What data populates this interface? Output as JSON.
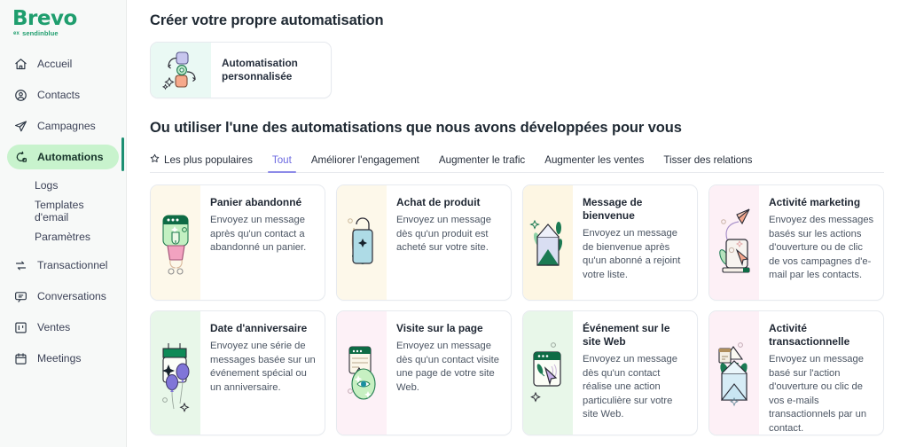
{
  "sidebar": {
    "logo": {
      "name": "Brevo",
      "prefix": "ex",
      "subname": "sendinblue"
    },
    "items": [
      {
        "label": "Accueil",
        "icon": "home-icon",
        "active": false,
        "sub": false
      },
      {
        "label": "Contacts",
        "icon": "contacts-icon",
        "active": false,
        "sub": false
      },
      {
        "label": "Campagnes",
        "icon": "send-icon",
        "active": false,
        "sub": false
      },
      {
        "label": "Automations",
        "icon": "automations-icon",
        "active": true,
        "sub": false
      },
      {
        "label": "Logs",
        "icon": "",
        "active": false,
        "sub": true
      },
      {
        "label": "Templates d'email",
        "icon": "",
        "active": false,
        "sub": true
      },
      {
        "label": "Paramètres",
        "icon": "",
        "active": false,
        "sub": true
      },
      {
        "label": "Transactionnel",
        "icon": "transactional-icon",
        "active": false,
        "sub": false
      },
      {
        "label": "Conversations",
        "icon": "chat-icon",
        "active": false,
        "sub": false
      },
      {
        "label": "Ventes",
        "icon": "sales-board-icon",
        "active": false,
        "sub": false
      },
      {
        "label": "Meetings",
        "icon": "calendar-icon",
        "active": false,
        "sub": false
      }
    ]
  },
  "main": {
    "section1_title": "Créer votre propre automatisation",
    "custom_card": {
      "label": "Automatisation personnalisée",
      "art_bg": "#eaf9f4"
    },
    "section2_title": "Ou utiliser l'une des automatisations que nous avons développées pour vous",
    "tabs": [
      {
        "label": "Les plus populaires",
        "icon": "star-icon",
        "active": false
      },
      {
        "label": "Tout",
        "icon": "",
        "active": true
      },
      {
        "label": "Améliorer l'engagement",
        "icon": "",
        "active": false
      },
      {
        "label": "Augmenter le trafic",
        "icon": "",
        "active": false
      },
      {
        "label": "Augmenter les ventes",
        "icon": "",
        "active": false
      },
      {
        "label": "Tisser des relations",
        "icon": "",
        "active": false
      }
    ],
    "accent_color": "#6c6ae0",
    "brand_color": "#1f9e6e",
    "cards": [
      {
        "title": "Panier abandonné",
        "desc": "Envoyez un message après qu'un contact a abandonné un panier.",
        "art": "abandoned-cart-illustration",
        "art_bg": "#fdf8ea"
      },
      {
        "title": "Achat de produit",
        "desc": "Envoyez un message dès qu'un produit est acheté sur votre site.",
        "art": "shopping-bag-illustration",
        "art_bg": "#fdf8ea"
      },
      {
        "title": "Message de bienvenue",
        "desc": "Envoyez un message de bienvenue après qu'un abonné a rejoint votre liste.",
        "art": "welcome-envelope-illustration",
        "art_bg": "#fdf6e3"
      },
      {
        "title": "Activité marketing",
        "desc": "Envoyez des messages basés sur les actions d'ouverture ou de clic de vos campagnes d'e-mail par les contacts.",
        "art": "marketing-activity-illustration",
        "art_bg": "#fdf0f6"
      },
      {
        "title": "Date d'anniversaire",
        "desc": "Envoyez une série de messages basée sur un événement spécial ou un anniversaire.",
        "art": "birthday-balloons-illustration",
        "art_bg": "#e8f7e9"
      },
      {
        "title": "Visite sur la page",
        "desc": "Envoyez un message dès qu'un contact visite une page de votre site Web.",
        "art": "page-visit-eye-illustration",
        "art_bg": "#fdf1f7"
      },
      {
        "title": "Événement sur le site Web",
        "desc": "Envoyez un message dès qu'un contact réalise une action particulière sur votre site Web.",
        "art": "website-event-cursor-illustration",
        "art_bg": "#e8f7e9"
      },
      {
        "title": "Activité transactionnelle",
        "desc": "Envoyez un message basé sur l'action d'ouverture ou clic de vos e-mails transactionnels par un contact.",
        "art": "transactional-envelope-illustration",
        "art_bg": "#fdf0f6"
      }
    ]
  }
}
